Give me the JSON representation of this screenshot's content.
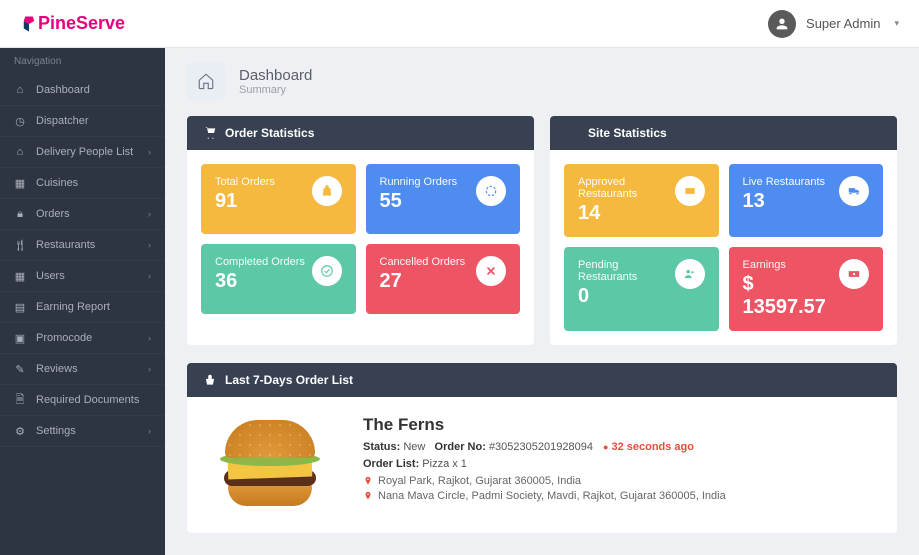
{
  "header": {
    "logo_pine": "Pine",
    "logo_serve": "Serve",
    "user_name": "Super Admin"
  },
  "sidebar": {
    "title": "Navigation",
    "items": [
      {
        "label": "Dashboard",
        "has_sub": false
      },
      {
        "label": "Dispatcher",
        "has_sub": false
      },
      {
        "label": "Delivery People List",
        "has_sub": true
      },
      {
        "label": "Cuisines",
        "has_sub": false
      },
      {
        "label": "Orders",
        "has_sub": true
      },
      {
        "label": "Restaurants",
        "has_sub": true
      },
      {
        "label": "Users",
        "has_sub": true
      },
      {
        "label": "Earning Report",
        "has_sub": false
      },
      {
        "label": "Promocode",
        "has_sub": true
      },
      {
        "label": "Reviews",
        "has_sub": true
      },
      {
        "label": "Required Documents",
        "has_sub": false
      },
      {
        "label": "Settings",
        "has_sub": true
      }
    ]
  },
  "page": {
    "title": "Dashboard",
    "subtitle": "Summary"
  },
  "order_stats": {
    "title": "Order Statistics",
    "cards": [
      {
        "label": "Total Orders",
        "value": "91",
        "color": "yellow"
      },
      {
        "label": "Running Orders",
        "value": "55",
        "color": "blue"
      },
      {
        "label": "Completed Orders",
        "value": "36",
        "color": "green"
      },
      {
        "label": "Cancelled Orders",
        "value": "27",
        "color": "red"
      }
    ]
  },
  "site_stats": {
    "title": "Site Statistics",
    "cards": [
      {
        "label": "Approved Restaurants",
        "value": "14",
        "color": "yellow"
      },
      {
        "label": "Live Restaurants",
        "value": "13",
        "color": "blue"
      },
      {
        "label": "Pending Restaurants",
        "value": "0",
        "color": "green"
      },
      {
        "label": "Earnings",
        "value": "$ 13597.57",
        "color": "red"
      }
    ]
  },
  "recent": {
    "title": "Last 7-Days Order List",
    "order": {
      "restaurant": "The Ferns",
      "status_label": "Status:",
      "status": "New",
      "order_no_label": "Order No:",
      "order_no": "#3052305201928094",
      "time_ago": "32 seconds ago",
      "list_label": "Order List:",
      "list": "Pizza x 1",
      "addr1": "Royal Park, Rajkot, Gujarat 360005, India",
      "addr2": "Nana Mava Circle, Padmi Society, Mavdi, Rajkot, Gujarat 360005, India"
    }
  }
}
